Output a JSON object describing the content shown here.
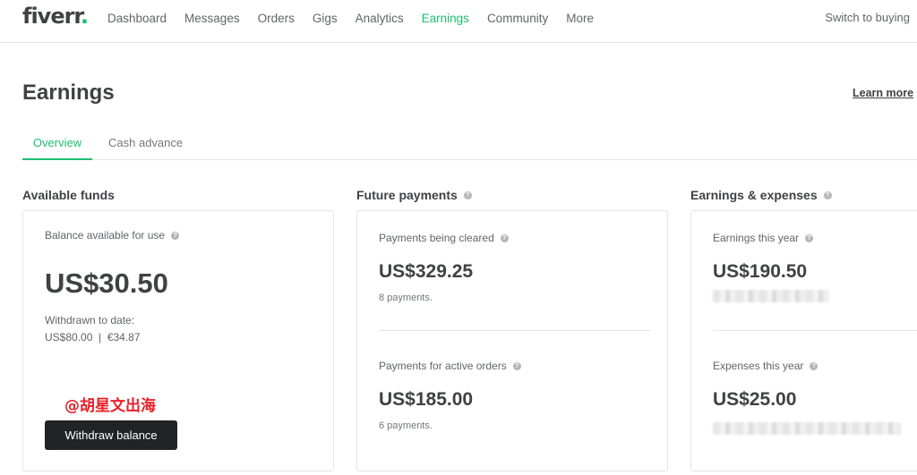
{
  "header": {
    "logo_text": "fiverr",
    "logo_dot": ".",
    "nav": [
      {
        "label": "Dashboard"
      },
      {
        "label": "Messages"
      },
      {
        "label": "Orders"
      },
      {
        "label": "Gigs"
      },
      {
        "label": "Analytics"
      },
      {
        "label": "Earnings"
      },
      {
        "label": "Community"
      },
      {
        "label": "More"
      }
    ],
    "active_nav": "Earnings",
    "switch_label": "Switch to buying"
  },
  "page": {
    "title": "Earnings",
    "learn_more": "Learn more"
  },
  "tabs": [
    {
      "label": "Overview"
    },
    {
      "label": "Cash advance"
    }
  ],
  "active_tab": "Overview",
  "available_funds": {
    "section_title": "Available funds",
    "balance_label": "Balance available for use",
    "balance_amount": "US$30.50",
    "withdrawn_label": "Withdrawn to date:",
    "withdrawn_values": "US$80.00  |  €34.87",
    "watermark": "@胡星文出海",
    "withdraw_button": "Withdraw balance"
  },
  "future_payments": {
    "section_title": "Future payments",
    "being_cleared_label": "Payments being cleared",
    "being_cleared_amount": "US$329.25",
    "being_cleared_count": "8 payments.",
    "active_orders_label": "Payments for active orders",
    "active_orders_amount": "US$185.00",
    "active_orders_count": "6 payments."
  },
  "earnings_expenses": {
    "section_title": "Earnings & expenses",
    "earnings_label": "Earnings this year",
    "earnings_amount": "US$190.50",
    "expenses_label": "Expenses this year",
    "expenses_amount": "US$25.00"
  },
  "icons": {
    "help": "question-circle-icon"
  },
  "colors": {
    "accent": "#1dbf73",
    "text": "#404145",
    "button_bg": "#222325"
  }
}
